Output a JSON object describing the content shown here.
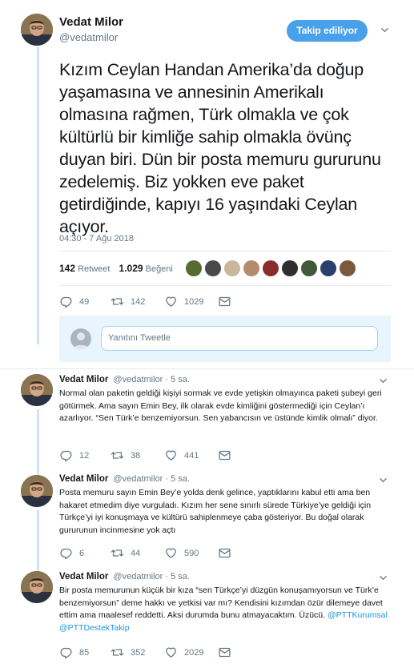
{
  "main_tweet": {
    "name": "Vedat Milor",
    "handle": "@vedatmilor",
    "follow_label": "Takip ediliyor",
    "text": "Kızım Ceylan Handan Amerika’da doğup yaşamasına ve annesinin Amerikalı olmasına rağmen, Türk olmakla ve çok kültürlü bir kimliğe sahip olmakla övünç duyan biri. Dün bir posta memuru gururunu zedelemiş. Biz yokken eve paket getirdiğinde, kapıyı 16 yaşındaki Ceylan açıyor.",
    "timestamp": "04:30 - 7 Ağu 2018",
    "retweet_count": "142",
    "retweet_label": "Retweet",
    "like_count": "1.029",
    "like_label": "Beğeni",
    "actions": {
      "reply": "49",
      "retweet": "142",
      "like": "1029"
    }
  },
  "reply_box": {
    "placeholder": "Yanıtını Tweetle"
  },
  "replies": [
    {
      "name": "Vedat Milor",
      "handle": "@vedatmilor",
      "time": "· 5 sa.",
      "text": "Normal olan paketin geldiği kişiyi sormak ve evde yetişkin olmayınca paketi şubeyi geri götürmek. Ama sayın Emin Bey, ilk olarak evde kimliğini göstermediği için Ceylan’ı azarlıyor. “Sen Türk’e benzemiyorsun. Sen yabancısın ve üstünde kimlik olmalı” diyor.",
      "actions": {
        "reply": "12",
        "retweet": "38",
        "like": "441"
      }
    },
    {
      "name": "Vedat Milor",
      "handle": "@vedatmilor",
      "time": "· 5 sa.",
      "text": "Posta memuru sayın Emin Bey’e yolda denk gelince, yaptıklarını kabul etti ama ben hakaret etmedim diye vurguladı. Kızım her sene sınırlı sürede Türkiye’ye geldiği için Türkçe’yi iyi konuşmaya ve kültürü sahiplenmeye çaba gösteriyor. Bu doğal olarak gururunun incinmesine yok açtı",
      "actions": {
        "reply": "6",
        "retweet": "44",
        "like": "590"
      }
    },
    {
      "name": "Vedat Milor",
      "handle": "@vedatmilor",
      "time": "· 5 sa.",
      "text": "Bir posta memurunun küçük bir kıza “sen Türkçe’yi düzgün konuşamıyorsun ve Türk’e benzemiyorsun” deme hakkı ve yetkisi var mı? Kendisini kızımdan özür dilemeye davet ettim ama maalesef reddetti. Aksi durumda bunu atmayacaktım. Üzücü.",
      "mentions": "@PTTKurumsal @PTTDestekTakip",
      "actions": {
        "reply": "85",
        "retweet": "352",
        "like": "2029"
      }
    }
  ],
  "colors": {
    "accent": "#1da1f2",
    "follow_button": "#4aa1eb",
    "muted": "#657786",
    "thread_line": "#cfe4f7"
  }
}
